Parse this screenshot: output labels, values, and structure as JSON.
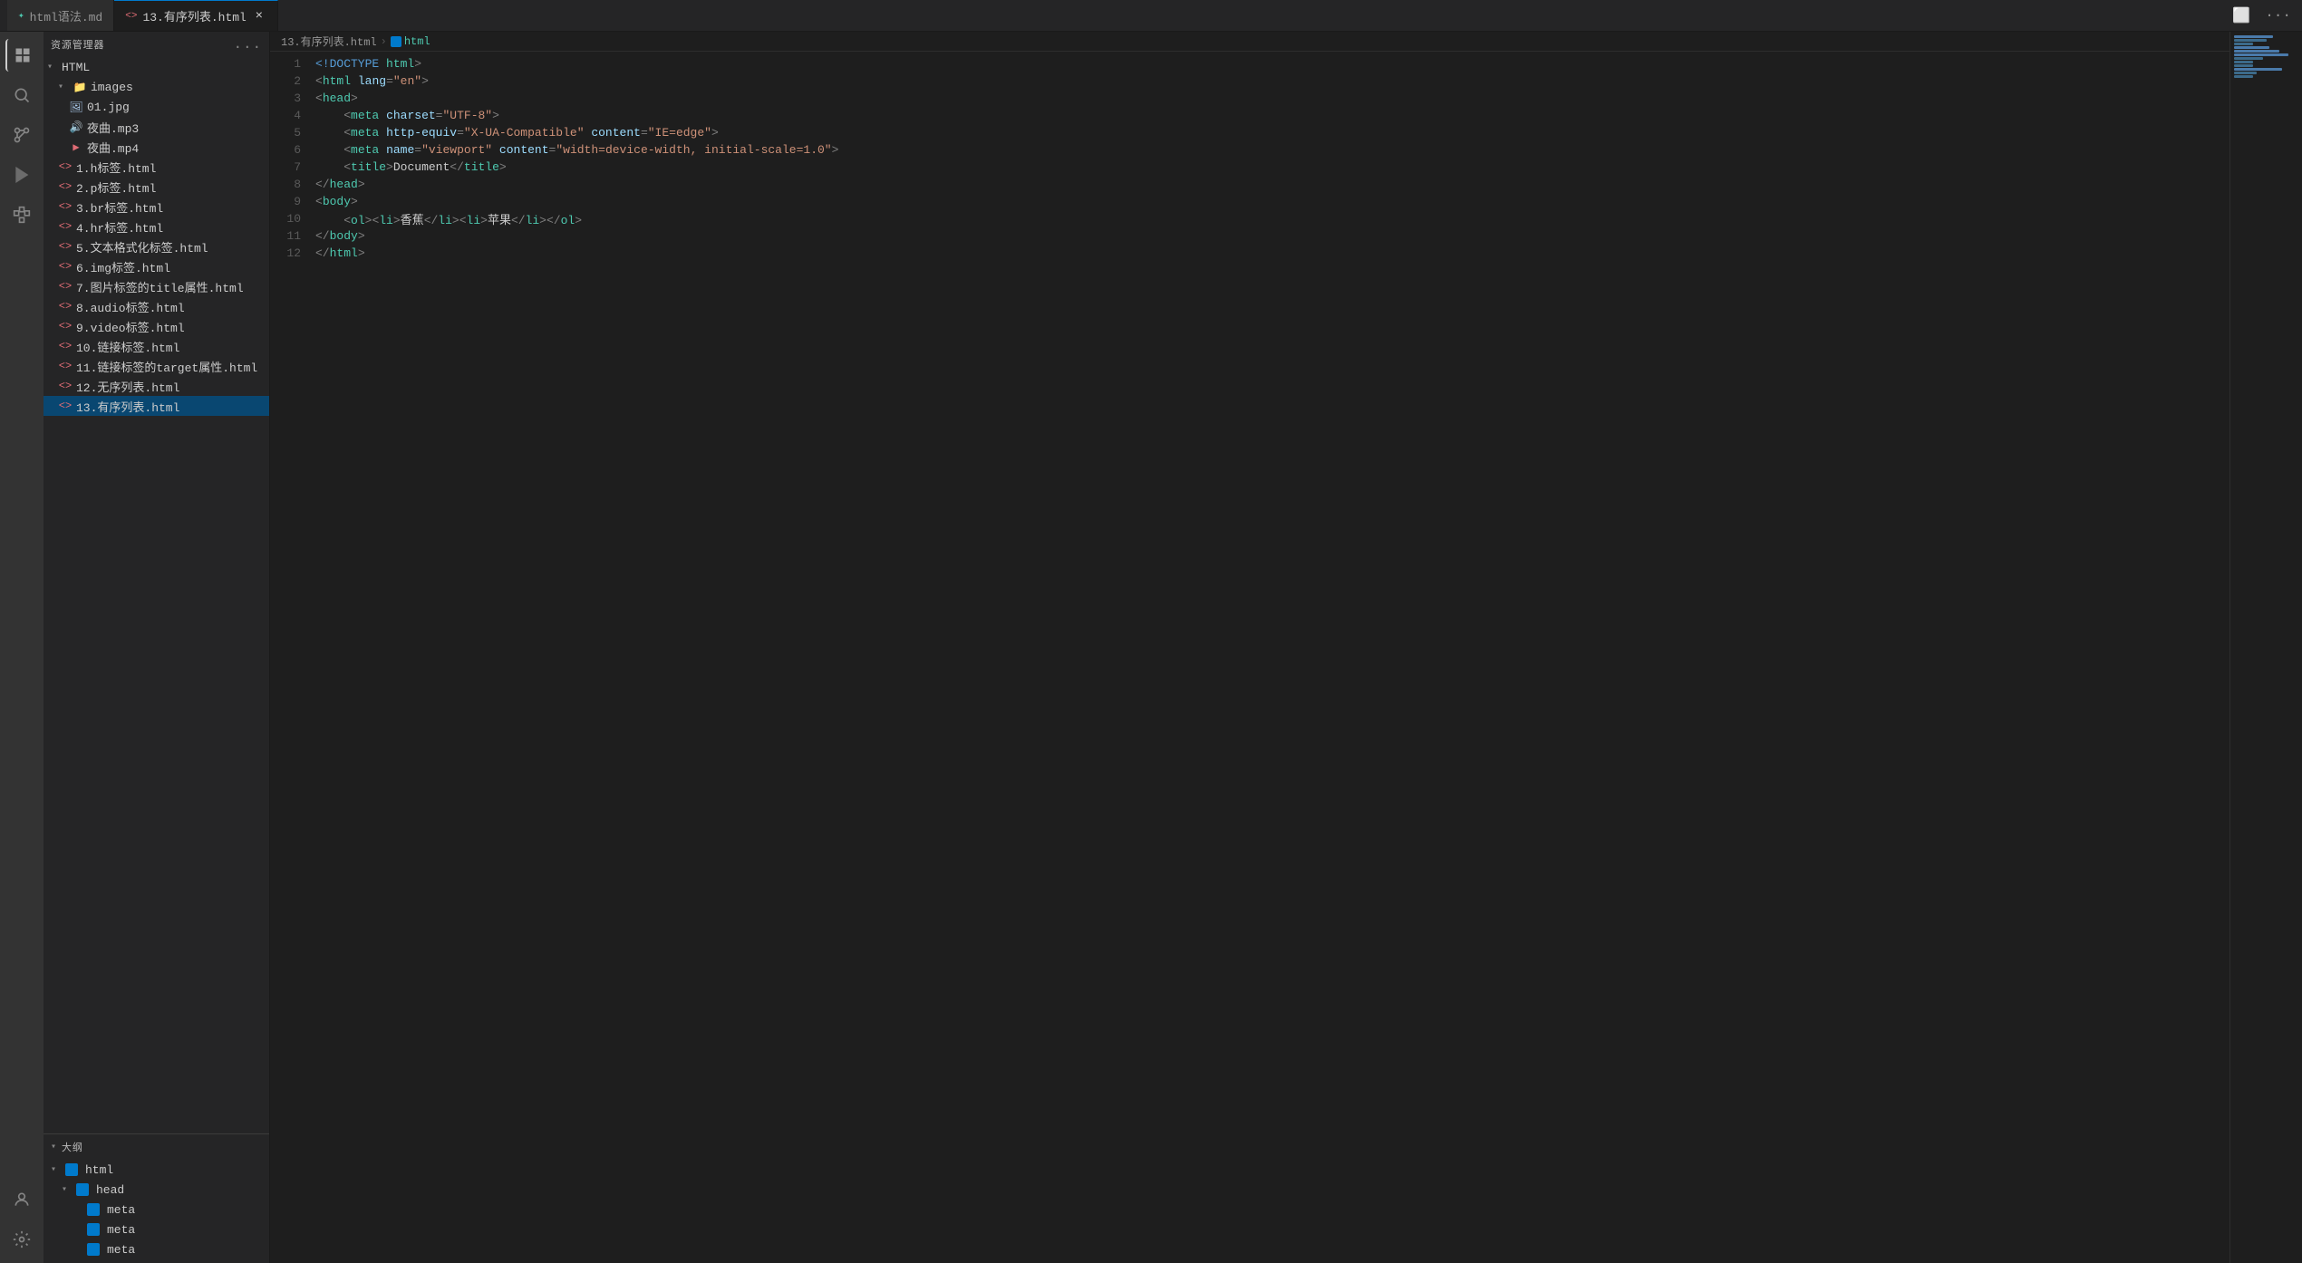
{
  "titleBar": {
    "tabs": [
      {
        "id": "tab-md",
        "label": "html语法.md",
        "icon": "📄",
        "active": false,
        "closable": false
      },
      {
        "id": "tab-html",
        "label": "13.有序列表.html",
        "icon": "<>",
        "active": true,
        "closable": true
      }
    ],
    "actions": [
      "split-editor",
      "more"
    ]
  },
  "sidebar": {
    "title": "资源管理器",
    "moreBtn": "...",
    "tree": {
      "root": "HTML",
      "items": [
        {
          "id": "folder-images",
          "label": "images",
          "level": "level1",
          "type": "folder",
          "expanded": true
        },
        {
          "id": "file-01jpg",
          "label": "01.jpg",
          "level": "level2",
          "type": "image"
        },
        {
          "id": "file-yq-mp3",
          "label": "夜曲.mp3",
          "level": "level2",
          "type": "audio"
        },
        {
          "id": "file-yq-mp4",
          "label": "夜曲.mp4",
          "level": "level2",
          "type": "video"
        },
        {
          "id": "file-1",
          "label": "1.h标签.html",
          "level": "level1",
          "type": "html"
        },
        {
          "id": "file-2",
          "label": "2.p标签.html",
          "level": "level1",
          "type": "html"
        },
        {
          "id": "file-3",
          "label": "3.br标签.html",
          "level": "level1",
          "type": "html"
        },
        {
          "id": "file-4",
          "label": "4.hr标签.html",
          "level": "level1",
          "type": "html"
        },
        {
          "id": "file-5",
          "label": "5.文本格式化标签.html",
          "level": "level1",
          "type": "html"
        },
        {
          "id": "file-6",
          "label": "6.img标签.html",
          "level": "level1",
          "type": "html"
        },
        {
          "id": "file-7",
          "label": "7.图片标签的title属性.html",
          "level": "level1",
          "type": "html"
        },
        {
          "id": "file-8",
          "label": "8.audio标签.html",
          "level": "level1",
          "type": "html"
        },
        {
          "id": "file-9",
          "label": "9.video标签.html",
          "level": "level1",
          "type": "html"
        },
        {
          "id": "file-10",
          "label": "10.链接标签.html",
          "level": "level1",
          "type": "html"
        },
        {
          "id": "file-11",
          "label": "11.链接标签的target属性.html",
          "level": "level1",
          "type": "html"
        },
        {
          "id": "file-12",
          "label": "12.无序列表.html",
          "level": "level1",
          "type": "html"
        },
        {
          "id": "file-13",
          "label": "13.有序列表.html",
          "level": "level1",
          "type": "html",
          "selected": true
        }
      ]
    }
  },
  "outline": {
    "title": "大纲",
    "items": [
      {
        "id": "outline-html",
        "label": "html",
        "level": "level0",
        "expanded": true
      },
      {
        "id": "outline-head",
        "label": "head",
        "level": "level1",
        "expanded": true
      },
      {
        "id": "outline-meta1",
        "label": "meta",
        "level": "level2"
      },
      {
        "id": "outline-meta2",
        "label": "meta",
        "level": "level2"
      },
      {
        "id": "outline-meta3",
        "label": "meta",
        "level": "level2"
      }
    ]
  },
  "breadcrumb": {
    "parts": [
      "13.有序列表.html",
      "html"
    ]
  },
  "editor": {
    "filename": "13.有序列表.html",
    "lines": [
      {
        "num": "1",
        "tokens": [
          {
            "t": "<!DOCTYPE ",
            "c": "doctype"
          },
          {
            "t": "html",
            "c": "tag"
          },
          {
            "t": ">",
            "c": "punct"
          }
        ]
      },
      {
        "num": "2",
        "tokens": [
          {
            "t": "<",
            "c": "punct"
          },
          {
            "t": "html",
            "c": "tag"
          },
          {
            "t": " ",
            "c": "txt"
          },
          {
            "t": "lang",
            "c": "attr"
          },
          {
            "t": "=",
            "c": "punct"
          },
          {
            "t": "\"en\"",
            "c": "val"
          },
          {
            "t": ">",
            "c": "punct"
          }
        ]
      },
      {
        "num": "3",
        "tokens": [
          {
            "t": "<",
            "c": "punct"
          },
          {
            "t": "head",
            "c": "tag"
          },
          {
            "t": ">",
            "c": "punct"
          }
        ]
      },
      {
        "num": "4",
        "tokens": [
          {
            "t": "    <",
            "c": "punct"
          },
          {
            "t": "meta",
            "c": "tag"
          },
          {
            "t": " ",
            "c": "txt"
          },
          {
            "t": "charset",
            "c": "attr"
          },
          {
            "t": "=",
            "c": "punct"
          },
          {
            "t": "\"UTF-8\"",
            "c": "val"
          },
          {
            "t": ">",
            "c": "punct"
          }
        ]
      },
      {
        "num": "5",
        "tokens": [
          {
            "t": "    <",
            "c": "punct"
          },
          {
            "t": "meta",
            "c": "tag"
          },
          {
            "t": " ",
            "c": "txt"
          },
          {
            "t": "http-equiv",
            "c": "attr"
          },
          {
            "t": "=",
            "c": "punct"
          },
          {
            "t": "\"X-UA-Compatible\"",
            "c": "val"
          },
          {
            "t": " ",
            "c": "txt"
          },
          {
            "t": "content",
            "c": "attr"
          },
          {
            "t": "=",
            "c": "punct"
          },
          {
            "t": "\"IE=edge\"",
            "c": "val"
          },
          {
            "t": ">",
            "c": "punct"
          }
        ]
      },
      {
        "num": "6",
        "tokens": [
          {
            "t": "    <",
            "c": "punct"
          },
          {
            "t": "meta",
            "c": "tag"
          },
          {
            "t": " ",
            "c": "txt"
          },
          {
            "t": "name",
            "c": "attr"
          },
          {
            "t": "=",
            "c": "punct"
          },
          {
            "t": "\"viewport\"",
            "c": "val"
          },
          {
            "t": " ",
            "c": "txt"
          },
          {
            "t": "content",
            "c": "attr"
          },
          {
            "t": "=",
            "c": "punct"
          },
          {
            "t": "\"width=device-width, initial-scale=1.0\"",
            "c": "val"
          },
          {
            "t": ">",
            "c": "punct"
          }
        ]
      },
      {
        "num": "7",
        "tokens": [
          {
            "t": "    <",
            "c": "punct"
          },
          {
            "t": "title",
            "c": "tag"
          },
          {
            "t": ">",
            "c": "punct"
          },
          {
            "t": "Document",
            "c": "txt"
          },
          {
            "t": "</",
            "c": "punct"
          },
          {
            "t": "title",
            "c": "tag"
          },
          {
            "t": ">",
            "c": "punct"
          }
        ]
      },
      {
        "num": "8",
        "tokens": [
          {
            "t": "</",
            "c": "punct"
          },
          {
            "t": "head",
            "c": "tag"
          },
          {
            "t": ">",
            "c": "punct"
          }
        ]
      },
      {
        "num": "9",
        "tokens": [
          {
            "t": "<",
            "c": "punct"
          },
          {
            "t": "body",
            "c": "tag"
          },
          {
            "t": ">",
            "c": "punct"
          }
        ]
      },
      {
        "num": "10",
        "tokens": [
          {
            "t": "    <",
            "c": "punct"
          },
          {
            "t": "ol",
            "c": "tag"
          },
          {
            "t": ">",
            "c": "punct"
          },
          {
            "t": "<",
            "c": "punct"
          },
          {
            "t": "li",
            "c": "tag"
          },
          {
            "t": ">",
            "c": "punct"
          },
          {
            "t": "香蕉",
            "c": "txt"
          },
          {
            "t": "</",
            "c": "punct"
          },
          {
            "t": "li",
            "c": "tag"
          },
          {
            "t": ">",
            "c": "punct"
          },
          {
            "t": "<",
            "c": "punct"
          },
          {
            "t": "li",
            "c": "tag"
          },
          {
            "t": ">",
            "c": "punct"
          },
          {
            "t": "苹果",
            "c": "txt"
          },
          {
            "t": "</",
            "c": "punct"
          },
          {
            "t": "li",
            "c": "tag"
          },
          {
            "t": ">",
            "c": "punct"
          },
          {
            "t": "</",
            "c": "punct"
          },
          {
            "t": "ol",
            "c": "tag"
          },
          {
            "t": ">",
            "c": "punct"
          }
        ]
      },
      {
        "num": "11",
        "tokens": [
          {
            "t": "</",
            "c": "punct"
          },
          {
            "t": "body",
            "c": "tag"
          },
          {
            "t": ">",
            "c": "punct"
          }
        ]
      },
      {
        "num": "12",
        "tokens": [
          {
            "t": "</",
            "c": "punct"
          },
          {
            "t": "html",
            "c": "tag"
          },
          {
            "t": ">",
            "c": "punct"
          }
        ]
      }
    ]
  },
  "activityBar": {
    "icons": [
      {
        "id": "explorer",
        "symbol": "🗂",
        "active": true
      },
      {
        "id": "search",
        "symbol": "🔍",
        "active": false
      },
      {
        "id": "source-control",
        "symbol": "⑂",
        "active": false
      },
      {
        "id": "run",
        "symbol": "▷",
        "active": false
      },
      {
        "id": "extensions",
        "symbol": "⊞",
        "active": false
      }
    ],
    "bottomIcons": [
      {
        "id": "accounts",
        "symbol": "👤"
      },
      {
        "id": "settings",
        "symbol": "⚙"
      }
    ]
  }
}
